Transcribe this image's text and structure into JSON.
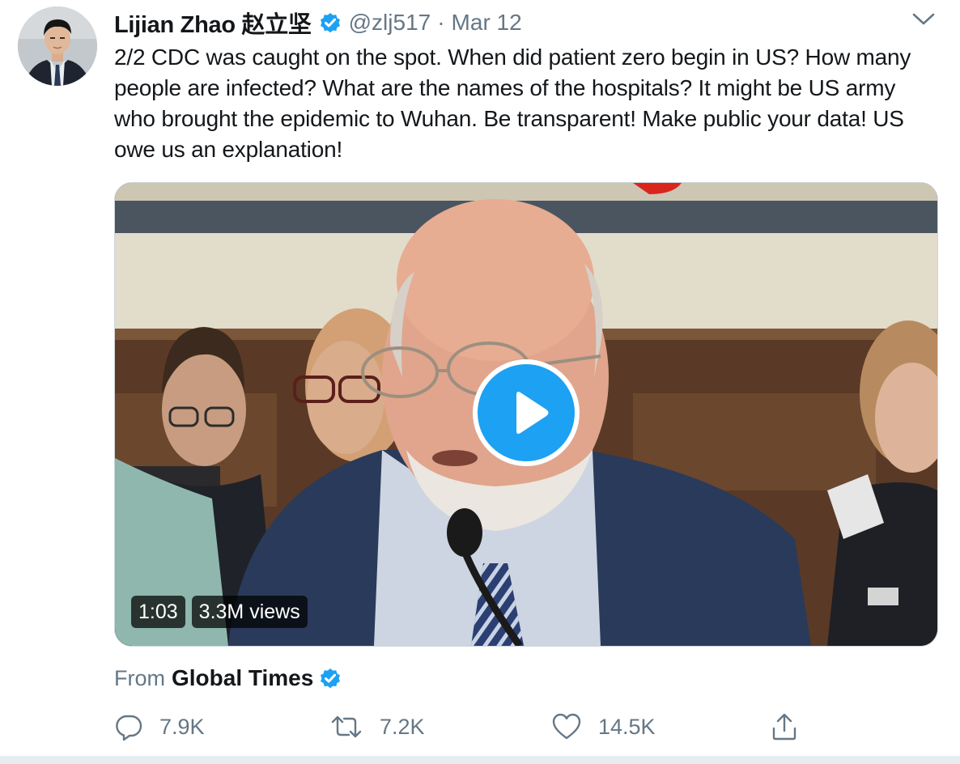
{
  "tweet": {
    "author": {
      "display_name": "Lijian Zhao 赵立坚",
      "handle": "@zlj517",
      "verified": true
    },
    "separator": "·",
    "date": "Mar 12",
    "text": "2/2 CDC was caught on the spot. When did patient zero begin in US? How many people are infected? What are the names of the hospitals? It might be US army who brought the epidemic to Wuhan. Be transparent! Make public your data! US owe us an explanation!",
    "media": {
      "type": "video",
      "duration": "1:03",
      "views": "3.3M views"
    },
    "source": {
      "label": "From",
      "name": "Global Times",
      "verified": true
    },
    "actions": {
      "replies": "7.9K",
      "retweets": "7.2K",
      "likes": "14.5K"
    }
  },
  "colors": {
    "verified_blue": "#1da1f2",
    "text_primary": "#14171a",
    "text_secondary": "#657786"
  },
  "icons": [
    "verified-badge-icon",
    "chevron-down-icon",
    "play-icon",
    "reply-icon",
    "retweet-icon",
    "like-icon",
    "share-icon"
  ]
}
